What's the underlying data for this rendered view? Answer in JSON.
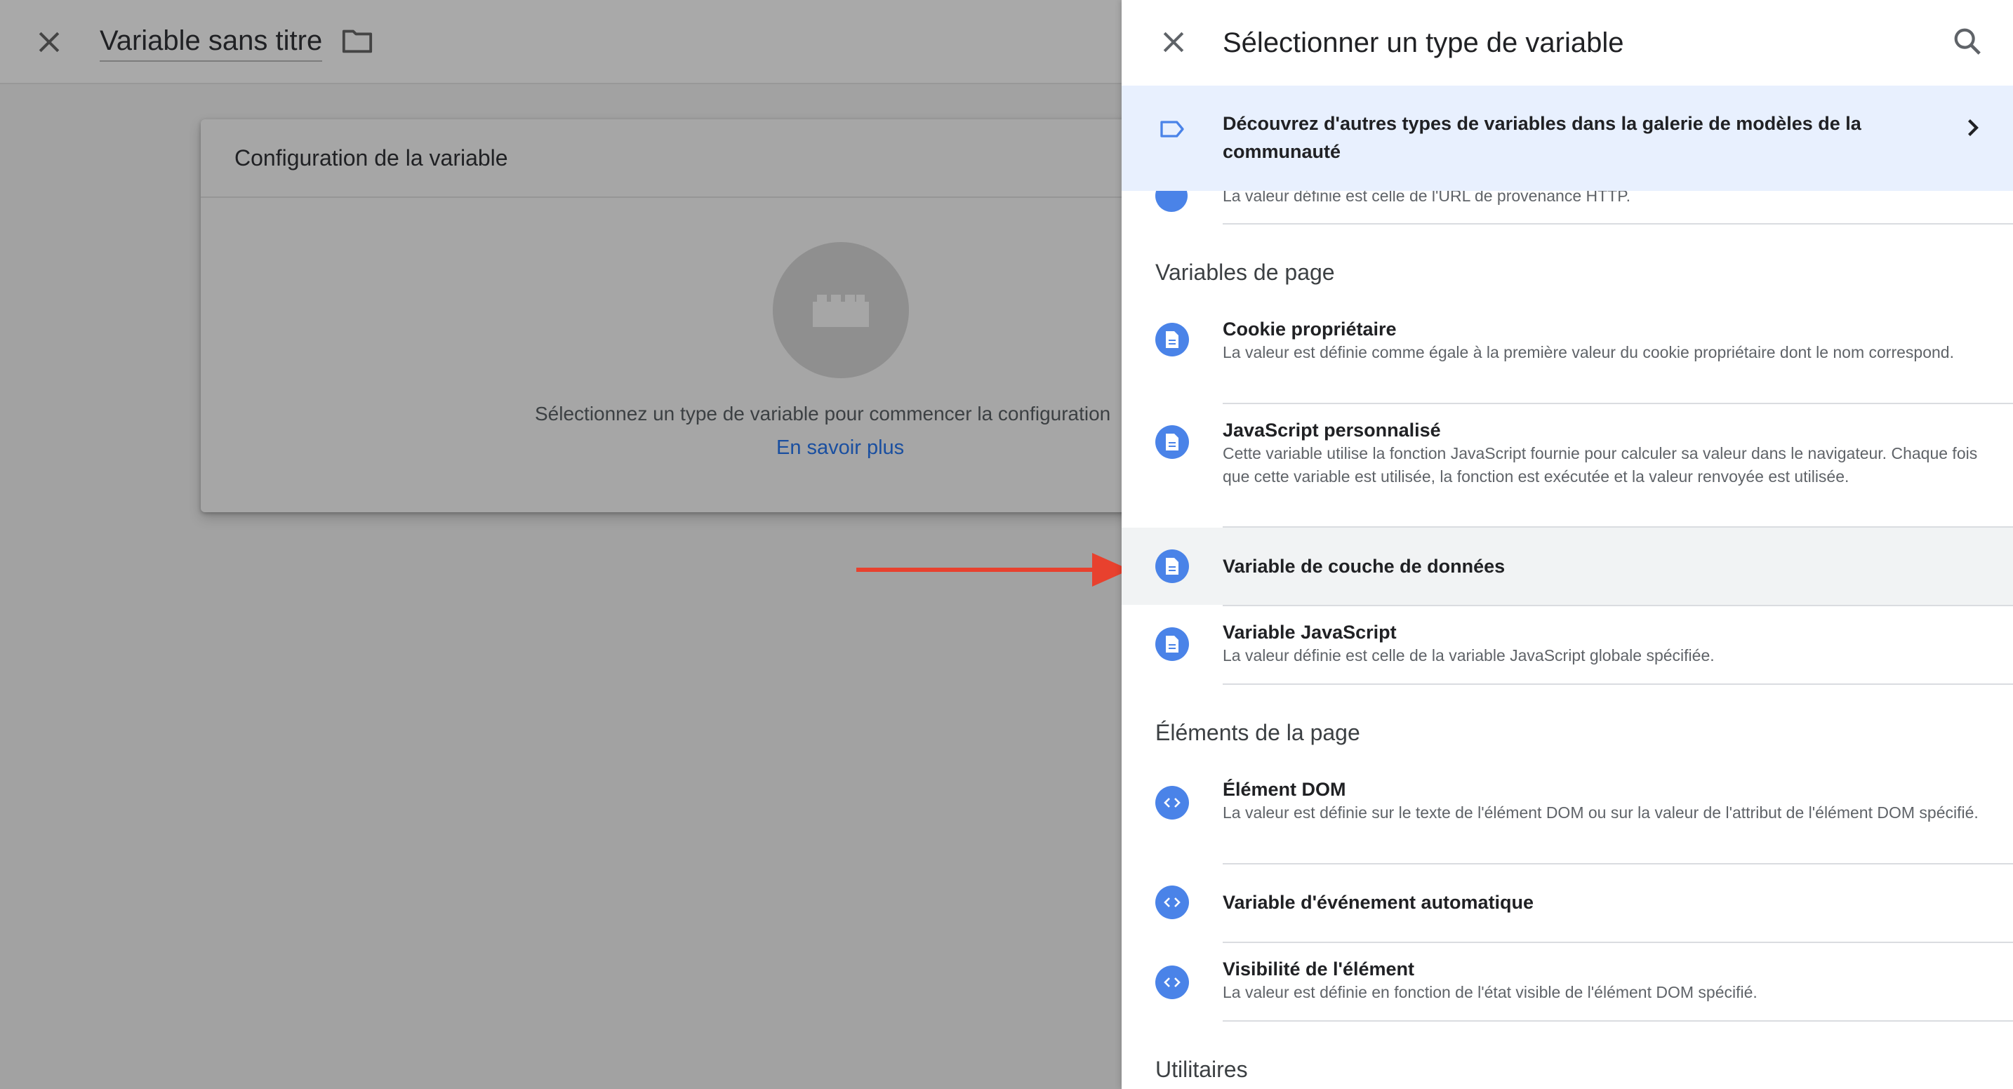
{
  "background": {
    "title": "Variable sans titre",
    "card": {
      "heading": "Configuration de la variable",
      "message": "Sélectionnez un type de variable pour commencer la configuration",
      "link": "En savoir plus"
    }
  },
  "panel": {
    "title": "Sélectionner un type de variable",
    "gallery": "Découvrez d'autres types de variables dans la galerie de modèles de la communauté",
    "partial_description": "La valeur définie est celle de l'URL de provenance HTTP.",
    "sections": [
      {
        "title": "Variables de page",
        "items": [
          {
            "name": "Cookie propriétaire",
            "description": "La valeur est définie comme égale à la première valeur du cookie propriétaire dont le nom correspond.",
            "icon": "document-icon"
          },
          {
            "name": "JavaScript personnalisé",
            "description": "Cette variable utilise la fonction JavaScript fournie pour calculer sa valeur dans le navigateur. Chaque fois que cette variable est utilisée, la fonction est exécutée et la valeur renvoyée est utilisée.",
            "icon": "document-icon"
          },
          {
            "name": "Variable de couche de données",
            "description": "",
            "icon": "document-icon"
          },
          {
            "name": "Variable JavaScript",
            "description": "La valeur définie est celle de la variable JavaScript globale spécifiée.",
            "icon": "document-icon"
          }
        ]
      },
      {
        "title": "Éléments de la page",
        "items": [
          {
            "name": "Élément DOM",
            "description": "La valeur est définie sur le texte de l'élément DOM ou sur la valeur de l'attribut de l'élément DOM spécifié.",
            "icon": "code-icon"
          },
          {
            "name": "Variable d'événement automatique",
            "description": "",
            "icon": "code-icon"
          },
          {
            "name": "Visibilité de l'élément",
            "description": "La valeur est définie en fonction de l'état visible de l'élément DOM spécifié.",
            "icon": "code-icon"
          }
        ]
      },
      {
        "title": "Utilitaires",
        "items": []
      }
    ]
  },
  "colors": {
    "accent_blue": "#4a83e8",
    "link_blue": "#1a4fa0",
    "gallery_bg": "#e8f0fe",
    "arrow_red": "#e8412e"
  }
}
